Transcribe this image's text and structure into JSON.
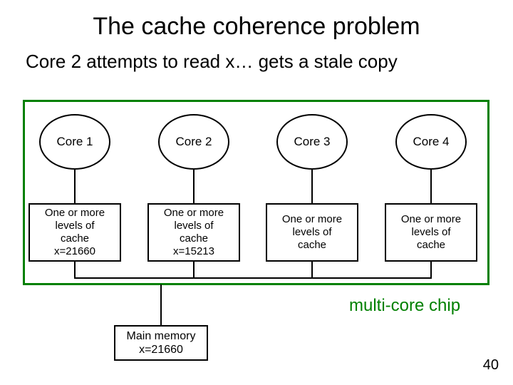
{
  "title": "The cache coherence problem",
  "subtitle": "Core 2 attempts to read x… gets a stale copy",
  "chip_label": "multi-core chip",
  "page_number": "40",
  "cores": {
    "c1": "Core 1",
    "c2": "Core 2",
    "c3": "Core 3",
    "c4": "Core 4"
  },
  "cache_common": {
    "l1": "One or more",
    "l2": "levels of",
    "l3": "cache"
  },
  "cache_values": {
    "c1": "x=21660",
    "c2": "x=15213",
    "c3": "",
    "c4": ""
  },
  "memory": {
    "l1": "Main memory",
    "l2": "x=21660"
  }
}
